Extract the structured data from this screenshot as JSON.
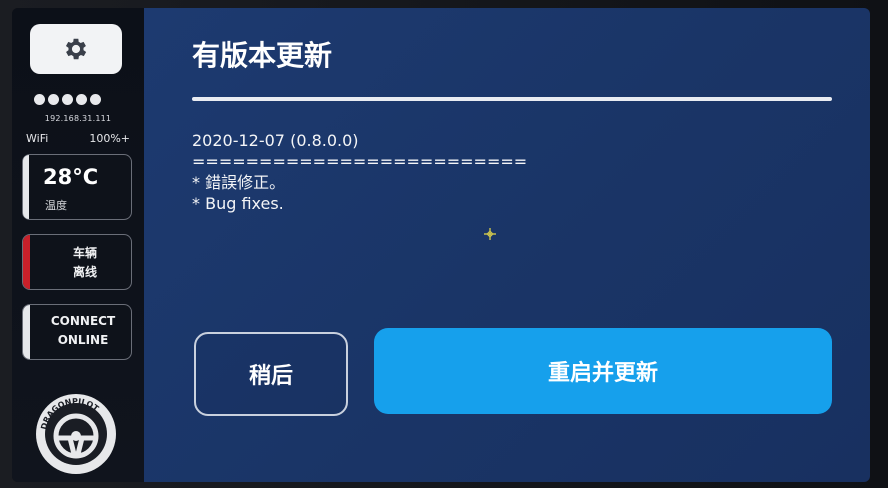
{
  "sidebar": {
    "ip_address": "192.168.31.111",
    "network_type": "WiFi",
    "network_strength": "100%+",
    "signal_dots": 5,
    "temperature": {
      "value": "28°C",
      "label": "温度"
    },
    "vehicle_status": {
      "line1": "车辆",
      "line2": "离线",
      "status_color": "#c8202a"
    },
    "connect_status": {
      "line1": "CONNECT",
      "line2": "ONLINE"
    },
    "logo_text": "DRAGONPILOT",
    "icons": {
      "settings": "gear-icon"
    }
  },
  "main": {
    "title": "有版本更新",
    "release_notes": [
      "2020-12-07 (0.8.0.0)",
      "=========================",
      "* 錯誤修正。",
      "* Bug fixes."
    ],
    "buttons": {
      "later": "稍后",
      "restart_update": "重启并更新"
    }
  },
  "colors": {
    "background": "#1b3668",
    "update_button": "#16a0ec",
    "vehicle_offline": "#c8202a"
  }
}
